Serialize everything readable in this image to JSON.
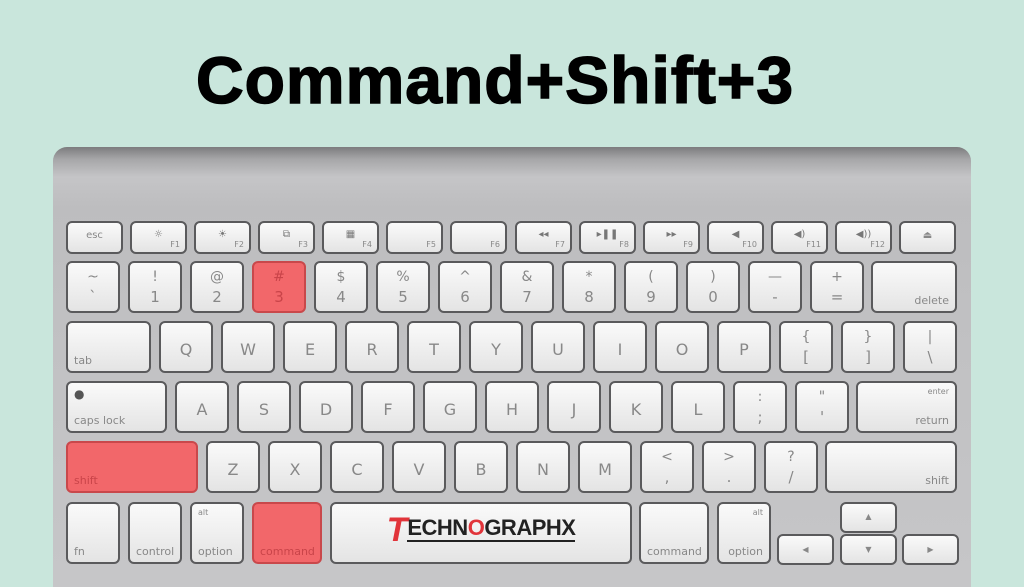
{
  "title": "Command+Shift+3",
  "highlight_color": "#f2676a",
  "logo": {
    "first": "T",
    "rest_a": "ECHN",
    "o": "O",
    "rest_b": "GRAPHX"
  },
  "fn_row": {
    "esc": "esc",
    "f1": "F1",
    "f2": "F2",
    "f3": "F3",
    "f4": "F4",
    "f5": "F5",
    "f6": "F6",
    "f7": "F7",
    "f8": "F8",
    "f9": "F9",
    "f10": "F10",
    "f11": "F11",
    "f12": "F12",
    "icons": {
      "f1": "☼",
      "f2": "☀",
      "f3": "⧉",
      "f4": "▦",
      "f7": "◂◂",
      "f8": "▸❚❚",
      "f9": "▸▸",
      "f10": "◀",
      "f11": "◀)",
      "f12": "◀))",
      "eject": "⏏"
    }
  },
  "num_row": [
    {
      "up": "~",
      "dn": "`"
    },
    {
      "up": "!",
      "dn": "1"
    },
    {
      "up": "@",
      "dn": "2"
    },
    {
      "up": "#",
      "dn": "3"
    },
    {
      "up": "$",
      "dn": "4"
    },
    {
      "up": "%",
      "dn": "5"
    },
    {
      "up": "^",
      "dn": "6"
    },
    {
      "up": "&",
      "dn": "7"
    },
    {
      "up": "*",
      "dn": "8"
    },
    {
      "up": "(",
      "dn": "9"
    },
    {
      "up": ")",
      "dn": "0"
    },
    {
      "up": "—",
      "dn": "-"
    },
    {
      "up": "+",
      "dn": "="
    }
  ],
  "delete": "delete",
  "tab": "tab",
  "qrow": [
    "Q",
    "W",
    "E",
    "R",
    "T",
    "Y",
    "U",
    "I",
    "O",
    "P"
  ],
  "brackets": [
    {
      "up": "{",
      "dn": "["
    },
    {
      "up": "}",
      "dn": "]"
    },
    {
      "up": "|",
      "dn": "\\"
    }
  ],
  "caps_lock": "caps lock",
  "arow": [
    "A",
    "S",
    "D",
    "F",
    "G",
    "H",
    "J",
    "K",
    "L"
  ],
  "semi": [
    {
      "up": ":",
      "dn": ";"
    },
    {
      "up": "\"",
      "dn": "'"
    }
  ],
  "enter": "enter",
  "return": "return",
  "shift": "shift",
  "zrow": [
    "Z",
    "X",
    "C",
    "V",
    "B",
    "N",
    "M"
  ],
  "punct": [
    {
      "up": "<",
      "dn": ","
    },
    {
      "up": ">",
      "dn": "."
    },
    {
      "up": "?",
      "dn": "/"
    }
  ],
  "bottom": {
    "fn": "fn",
    "control": "control",
    "alt": "alt",
    "option": "option",
    "command": "command"
  },
  "arrows": {
    "up": "▲",
    "down": "▼",
    "left": "◀",
    "right": "▶"
  }
}
